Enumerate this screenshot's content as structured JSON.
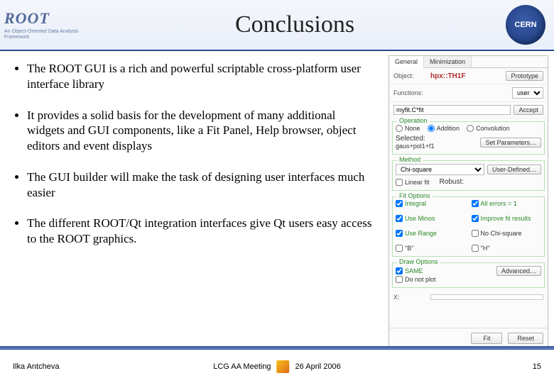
{
  "header": {
    "root": "ROOT",
    "root_sub": "An Object-Oriented\nData Analysis Framework",
    "title": "Conclusions",
    "cern": "CERN"
  },
  "bullets": [
    "The ROOT GUI is a rich and powerful scriptable cross-platform user interface library",
    "It provides a solid basis for the development of many additional widgets and GUI components, like a Fit Panel, Help browser, object editors and event displays",
    "The GUI builder will make the task of designing user interfaces much easier",
    "The different ROOT/Qt integration interfaces give Qt users easy access to the ROOT graphics."
  ],
  "panel": {
    "tabs": [
      "General",
      "Minimization"
    ],
    "object_label": "Object:",
    "object_value": "hpx::TH1F",
    "prototype_btn": "Prototype",
    "functions_label": "Functions:",
    "functions_value": "user",
    "input_value": "myfit.C*fit",
    "accept_btn": "Accept",
    "operation_title": "Operation",
    "radios": [
      "None",
      "Addition",
      "Convolution"
    ],
    "selected_label": "Selected:",
    "selected_value": "gaus+pol1+f1",
    "setparams_btn": "Set Parameters…",
    "method_title": "Method",
    "method_value": "Chi-square",
    "userdef_btn": "User-Defined…",
    "linear_fit": "Linear fit",
    "robust": "Robust:",
    "fitopts_title": "Fit Options",
    "fitopts_left": [
      "Integral",
      "Use Minos",
      "Use Range",
      "\"B\""
    ],
    "fitopts_right": [
      "All errors = 1",
      "Improve fit results",
      "No Chi-square",
      "\"H\""
    ],
    "drawopts_title": "Draw Options",
    "draw_same": "SAME",
    "draw_noplot": "Do not plot",
    "advanced_btn": "Advanced…",
    "x_label": "X:",
    "fit_btn": "Fit",
    "reset_btn": "Reset"
  },
  "footer": {
    "author": "Ilka Antcheva",
    "meeting": "LCG AA Meeting",
    "date": "26 April 2006",
    "page": "15"
  }
}
